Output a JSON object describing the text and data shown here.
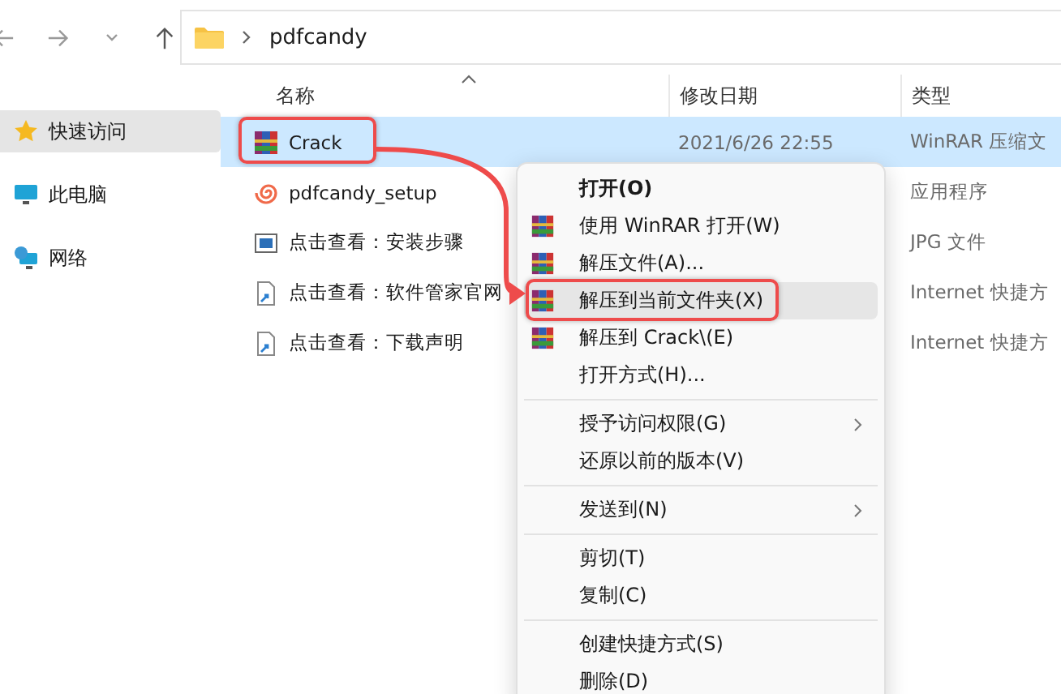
{
  "address": {
    "path": [
      "pdfcandy"
    ]
  },
  "sidebar": {
    "items": [
      {
        "label": "快速访问",
        "selected": true
      },
      {
        "label": "此电脑",
        "selected": false
      },
      {
        "label": "网络",
        "selected": false
      }
    ]
  },
  "columns": [
    "名称",
    "修改日期",
    "类型"
  ],
  "files": [
    {
      "kind": "archive",
      "name": "Crack",
      "date": "2021/6/26 22:55",
      "type": "WinRAR 压缩文",
      "selected": true,
      "annotated": true
    },
    {
      "kind": "app",
      "name": "pdfcandy_setup",
      "type": "应用程序",
      "selected": false,
      "annotated": false
    },
    {
      "kind": "image",
      "name": "点击查看：安装步骤",
      "type": "JPG 文件",
      "selected": false,
      "annotated": false
    },
    {
      "kind": "shortcut",
      "name": "点击查看：软件管家官网",
      "type": "Internet 快捷方",
      "selected": false,
      "annotated": false
    },
    {
      "kind": "shortcut",
      "name": "点击查看：下载声明",
      "type": "Internet 快捷方",
      "selected": false,
      "annotated": false
    }
  ],
  "context_menu": {
    "items": [
      {
        "kind": "default",
        "label": "打开(O)",
        "submenu": false,
        "selected": false,
        "annotated": false
      },
      {
        "kind": "archive",
        "label": "使用 WinRAR 打开(W)",
        "submenu": false,
        "selected": false,
        "annotated": false
      },
      {
        "kind": "archive",
        "label": "解压文件(A)...",
        "submenu": false,
        "selected": false,
        "annotated": false
      },
      {
        "kind": "archive",
        "label": "解压到当前文件夹(X)",
        "submenu": false,
        "selected": true,
        "annotated": true
      },
      {
        "kind": "archive",
        "label": "解压到 Crack\\(E)",
        "submenu": false,
        "selected": false,
        "annotated": false
      },
      {
        "kind": "plain",
        "label": "打开方式(H)...",
        "submenu": false,
        "selected": false,
        "annotated": false
      },
      {
        "kind": "separator"
      },
      {
        "kind": "plain",
        "label": "授予访问权限(G)",
        "submenu": true,
        "selected": false,
        "annotated": false
      },
      {
        "kind": "plain",
        "label": "还原以前的版本(V)",
        "submenu": false,
        "selected": false,
        "annotated": false
      },
      {
        "kind": "separator"
      },
      {
        "kind": "plain",
        "label": "发送到(N)",
        "submenu": true,
        "selected": false,
        "annotated": false
      },
      {
        "kind": "separator"
      },
      {
        "kind": "plain",
        "label": "剪切(T)",
        "submenu": false,
        "selected": false,
        "annotated": false
      },
      {
        "kind": "plain",
        "label": "复制(C)",
        "submenu": false,
        "selected": false,
        "annotated": false
      },
      {
        "kind": "separator"
      },
      {
        "kind": "plain",
        "label": "创建快捷方式(S)",
        "submenu": false,
        "selected": false,
        "annotated": false
      },
      {
        "kind": "plain",
        "label": "删除(D)",
        "submenu": false,
        "selected": false,
        "annotated": false
      }
    ]
  }
}
